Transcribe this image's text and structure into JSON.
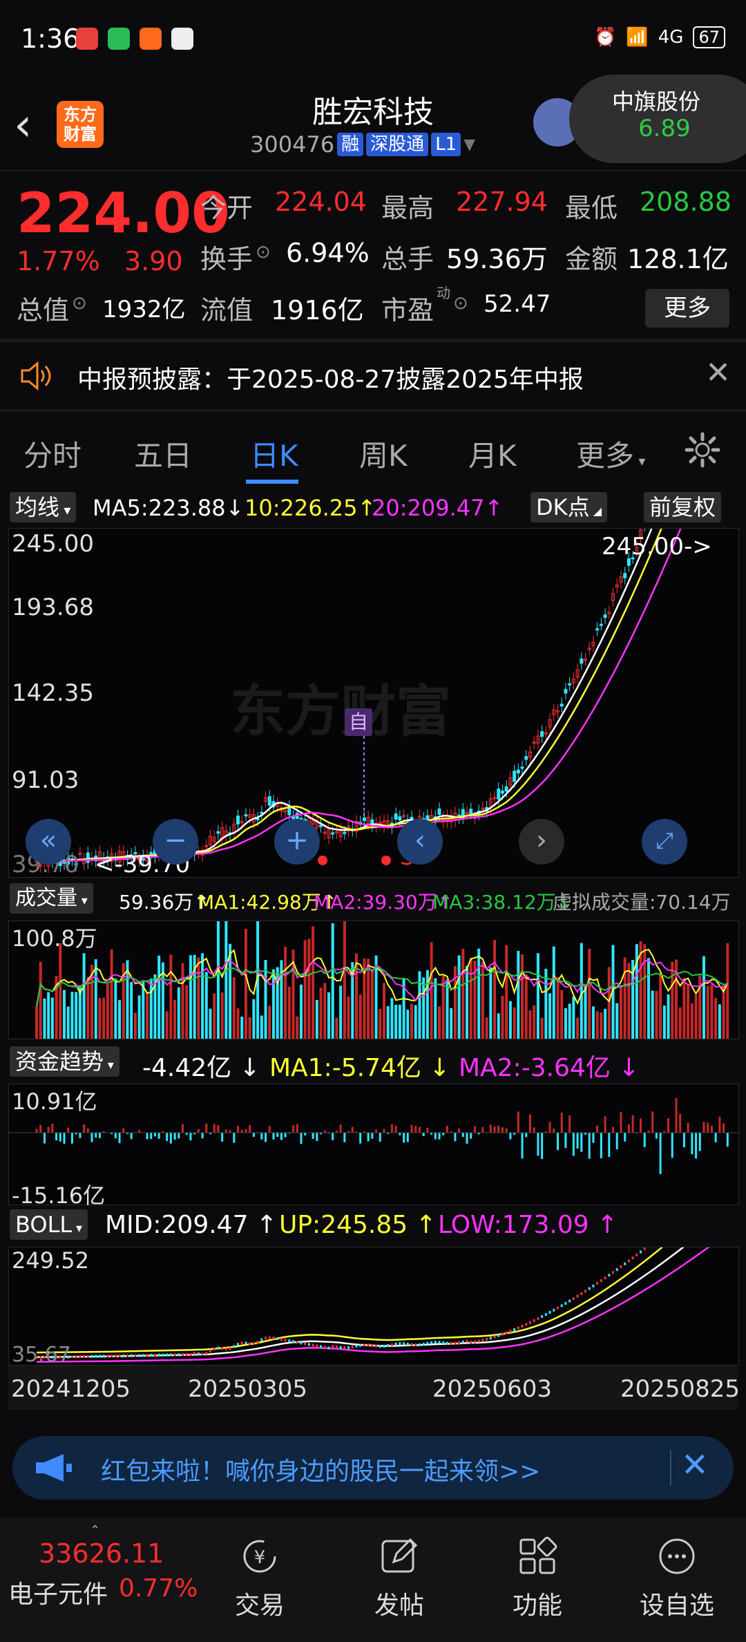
{
  "status_bar": {
    "time": "1:36",
    "signal": "4G",
    "battery": "67"
  },
  "header": {
    "title": "胜宏科技",
    "code": "300476",
    "tags": [
      "融",
      "深股通",
      "L1"
    ],
    "logo_text": [
      "东方",
      "财富"
    ],
    "popup": {
      "name": "中旗股份",
      "price": "6.89"
    }
  },
  "quote": {
    "price": "224.00",
    "pct": "1.77%",
    "change": "3.90",
    "rows": [
      [
        {
          "label": "今开",
          "value": "224.04",
          "color": "red"
        },
        {
          "label": "最高",
          "value": "227.94",
          "color": "red"
        },
        {
          "label": "最低",
          "value": "208.88",
          "color": "green"
        }
      ],
      [
        {
          "label": "换手",
          "value": "6.94%",
          "color": "white"
        },
        {
          "label": "总手",
          "value": "59.36万",
          "color": "white"
        },
        {
          "label": "金额",
          "value": "128.1亿",
          "color": "white"
        }
      ]
    ],
    "total_value_label": "总值",
    "total_value": "1932亿",
    "float_label": "流值",
    "float_value": "1916亿",
    "pe_label": "市盈",
    "pe_sup": "动",
    "pe_value": "52.47",
    "more": "更多"
  },
  "notice": {
    "text": "中报预披露：于2025-08-27披露2025年中报"
  },
  "tabs": {
    "items": [
      "分时",
      "五日",
      "日K",
      "周K",
      "月K",
      "更多"
    ],
    "active": 2
  },
  "main_chart": {
    "indicator": "均线",
    "ma5": "MA5:223.88",
    "ma10": "10:226.25",
    "ma20": "20:209.47",
    "dk": "DK点",
    "adj": "前复权",
    "y_ticks": [
      "245.00",
      "193.68",
      "142.35",
      "91.03",
      "39.70"
    ],
    "high_marker": "245.00->",
    "low_marker": "<-39.70",
    "self_marker": "自",
    "s_marker": "S"
  },
  "volume": {
    "indicator": "成交量",
    "current": "59.36万",
    "ma1": "MA1:42.98万",
    "ma2": "MA2:39.30万",
    "ma3": "MA3:38.12万",
    "virtual": "虚拟成交量:70.14万",
    "y_top": "100.8万"
  },
  "fund": {
    "indicator": "资金趋势",
    "current": "-4.42亿",
    "ma1": "MA1:-5.74亿",
    "ma2": "MA2:-3.64亿",
    "y_top": "10.91亿",
    "y_bottom": "-15.16亿"
  },
  "boll": {
    "indicator": "BOLL",
    "mid": "MID:209.47",
    "up": "UP:245.85",
    "low": "LOW:173.09",
    "y_top": "249.52",
    "y_bottom": "35.67",
    "dates": [
      "20241205",
      "20250305",
      "20250603",
      "20250825"
    ]
  },
  "promo": {
    "text": "红包来啦！喊你身边的股民一起来领>>"
  },
  "bottom_nav": {
    "index_value": "33626.11",
    "index_name": "电子元件",
    "index_pct": "0.77%",
    "items": [
      "交易",
      "发帖",
      "功能",
      "设自选"
    ]
  },
  "colors": {
    "up": "#ff2d2d",
    "down": "#28c840",
    "accent": "#3f8bff",
    "ma5": "#ffffff",
    "ma10": "#ffff33",
    "ma20": "#ff33ff"
  }
}
